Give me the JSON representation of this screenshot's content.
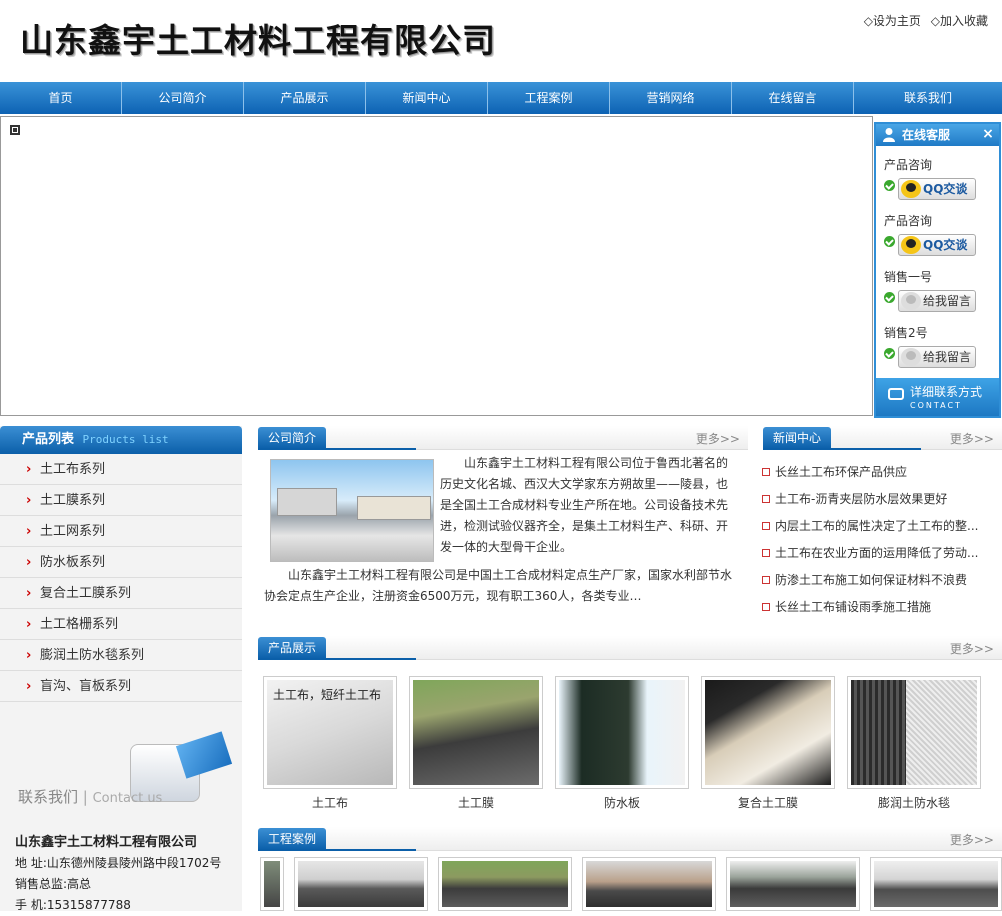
{
  "header": {
    "logo_text": "山东鑫宇土工材料工程有限公司",
    "set_home": "◇设为主页",
    "add_fav": "◇加入收藏"
  },
  "nav": [
    "首页",
    "公司简介",
    "产品展示",
    "新闻中心",
    "工程案例",
    "营销网络",
    "在线留言",
    "联系我们"
  ],
  "service": {
    "title": "在线客服",
    "close": "×",
    "items": [
      {
        "label": "产品咨询",
        "button": "QQ交谈"
      },
      {
        "label": "产品咨询",
        "button": "QQ交谈"
      },
      {
        "label": "销售一号",
        "button": "给我留言"
      },
      {
        "label": "销售2号",
        "button": "给我留言"
      }
    ],
    "footer_cn": "详细联系方式",
    "footer_en": "CONTACT"
  },
  "products_list": {
    "title": "产品列表",
    "title_en": "Products list",
    "items": [
      "土工布系列",
      "土工膜系列",
      "土工网系列",
      "防水板系列",
      "复合土工膜系列",
      "土工格栅系列",
      "膨润土防水毯系列",
      "盲沟、盲板系列"
    ]
  },
  "contact": {
    "title": "联系我们",
    "title_en": "Contact us",
    "company": "山东鑫宇土工材料工程有限公司",
    "address": "地  址:山东德州陵县陵州路中段1702号",
    "sales": "销售总监:高总",
    "phone": "手  机:15315877788"
  },
  "about": {
    "tab": "公司简介",
    "more": "更多>>",
    "text1": "山东鑫宇土工材料工程有限公司位于鲁西北著名的历史文化名城、西汉大文学家东方朔故里——陵县，也是全国土工合成材料专业生产所在地。公司设备技术先进，检测试验仪器齐全，是集土工材料生产、科研、开发一体的大型骨干企业。",
    "text2": "山东鑫宇土工材料工程有限公司是中国土工合成材料定点生产厂家，国家水利部节水协会定点生产企业，注册资金6500万元，现有职工360人，各类专业…"
  },
  "news": {
    "tab": "新闻中心",
    "more": "更多>>",
    "items": [
      "长丝土工布环保产品供应",
      "土工布-沥青夹层防水层效果更好",
      "内层土工布的属性决定了土工布的整...",
      "土工布在农业方面的运用降低了劳动...",
      "防渗土工布施工如何保证材料不浪费",
      "长丝土工布铺设雨季施工措施"
    ]
  },
  "products": {
    "tab": "产品展示",
    "more": "更多>>",
    "items": [
      {
        "name": "土工布",
        "overlay": "土工布，短纤土工布"
      },
      {
        "name": "土工膜"
      },
      {
        "name": "防水板"
      },
      {
        "name": "复合土工膜"
      },
      {
        "name": "膨润土防水毯"
      }
    ]
  },
  "cases": {
    "tab": "工程案例",
    "more": "更多>>"
  },
  "colors": {
    "nav_blue": "#0b5fa9",
    "accent_blue": "#3b8fd4"
  }
}
